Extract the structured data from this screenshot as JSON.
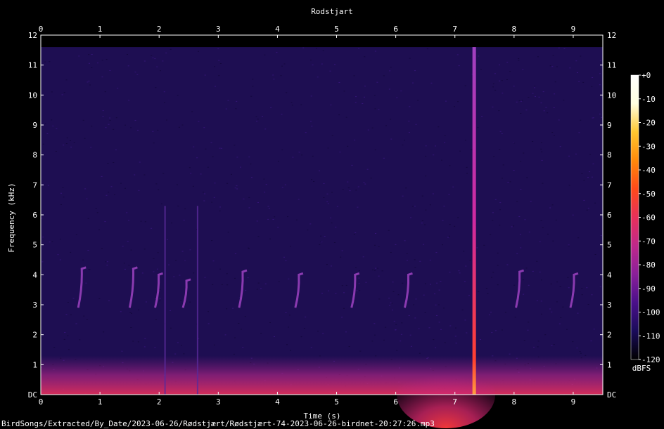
{
  "chart_data": {
    "type": "heatmap",
    "title": "Rodstjart",
    "xlabel": "Time (s)",
    "ylabel": "Frequency (kHz)",
    "xlim": [
      0,
      9.5
    ],
    "ylim": [
      0,
      12
    ],
    "x_ticks": [
      "0",
      "1",
      "2",
      "3",
      "4",
      "5",
      "6",
      "7",
      "8",
      "9"
    ],
    "y_ticks": [
      "DC",
      "1",
      "2",
      "3",
      "4",
      "5",
      "6",
      "7",
      "8",
      "9",
      "10",
      "11",
      "12"
    ],
    "colorbar": {
      "label": "dBFS",
      "ticks": [
        "+0",
        "-10",
        "-20",
        "-30",
        "-40",
        "-50",
        "-60",
        "-70",
        "-80",
        "-90",
        "-100",
        "-110",
        "-120"
      ],
      "range": [
        -120,
        0
      ],
      "colors": [
        "#000000",
        "#1a0b5a",
        "#4a0f8a",
        "#8a1f9a",
        "#c0288a",
        "#e8305a",
        "#ff4a1a",
        "#ff8a0a",
        "#ffc830",
        "#ffffe0",
        "#ffffff"
      ]
    },
    "background_color": "#1e0e52",
    "signal_max_khz": 11.6,
    "chirp_calls": [
      {
        "t": 0.68,
        "f_low": 2.9,
        "f_high": 4.2
      },
      {
        "t": 1.55,
        "f_low": 2.9,
        "f_high": 4.2
      },
      {
        "t": 1.98,
        "f_low": 2.9,
        "f_high": 4.0
      },
      {
        "t": 2.45,
        "f_low": 2.9,
        "f_high": 3.8
      },
      {
        "t": 3.4,
        "f_low": 2.9,
        "f_high": 4.1
      },
      {
        "t": 4.35,
        "f_low": 2.9,
        "f_high": 4.0
      },
      {
        "t": 5.3,
        "f_low": 2.9,
        "f_high": 4.0
      },
      {
        "t": 6.2,
        "f_low": 2.9,
        "f_high": 4.0
      },
      {
        "t": 8.08,
        "f_low": 2.9,
        "f_high": 4.1
      },
      {
        "t": 9.0,
        "f_low": 2.9,
        "f_high": 4.0
      }
    ],
    "vertical_lines_s": [
      2.1,
      2.65,
      7.32
    ],
    "broadband_click_s": 7.32
  },
  "footer": {
    "file_path": "BirdSongs/Extracted/By_Date/2023-06-26/Rødstjært/Rødstjært-74-2023-06-26-birdnet-20:27:26.mp3"
  }
}
